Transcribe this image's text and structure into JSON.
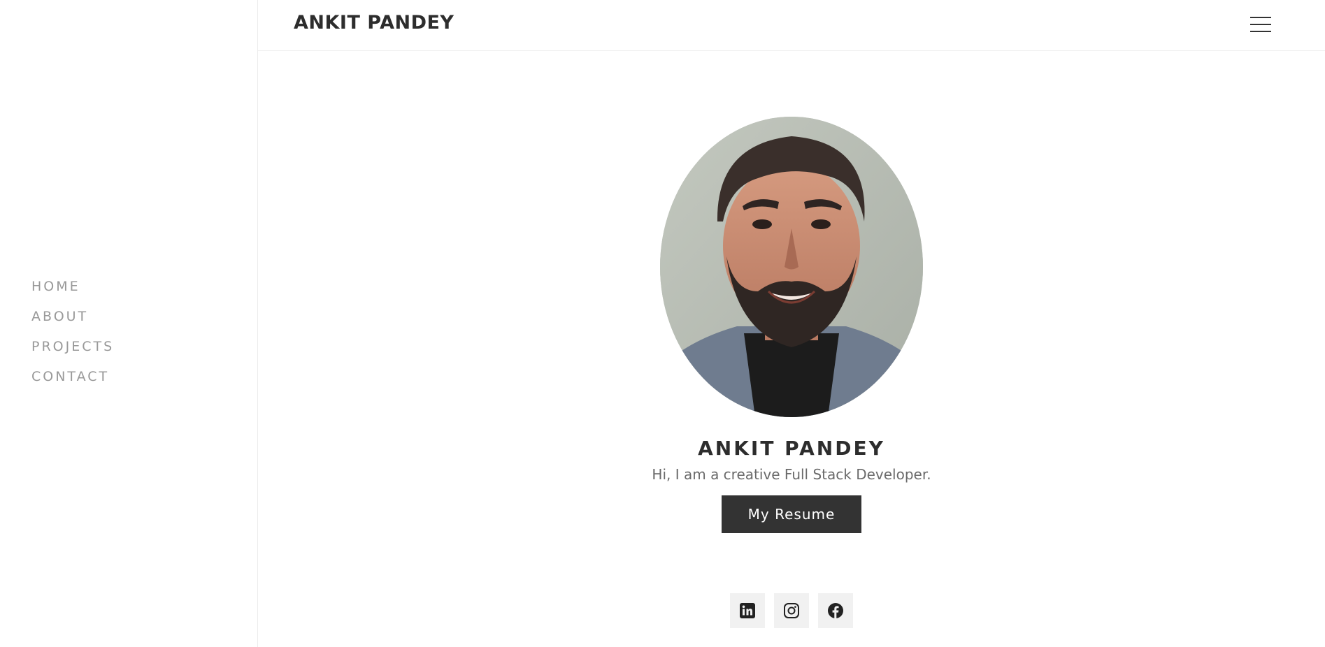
{
  "header": {
    "brand": "ANKIT PANDEY",
    "menu_icon": "hamburger-menu-icon"
  },
  "sidebar": {
    "items": [
      {
        "label": "HOME"
      },
      {
        "label": "ABOUT"
      },
      {
        "label": "PROJECTS"
      },
      {
        "label": "CONTACT"
      }
    ]
  },
  "hero": {
    "name": "ANKIT PANDEY",
    "subtitle": "Hi, I am a creative Full Stack Developer.",
    "resume_button": "My Resume"
  },
  "socials": [
    {
      "icon": "linkedin-icon"
    },
    {
      "icon": "instagram-icon"
    },
    {
      "icon": "facebook-icon"
    }
  ],
  "colors": {
    "text_dark": "#333333",
    "nav_gray": "#999999",
    "button_bg": "#333333",
    "social_bg": "#f1f1f1"
  }
}
